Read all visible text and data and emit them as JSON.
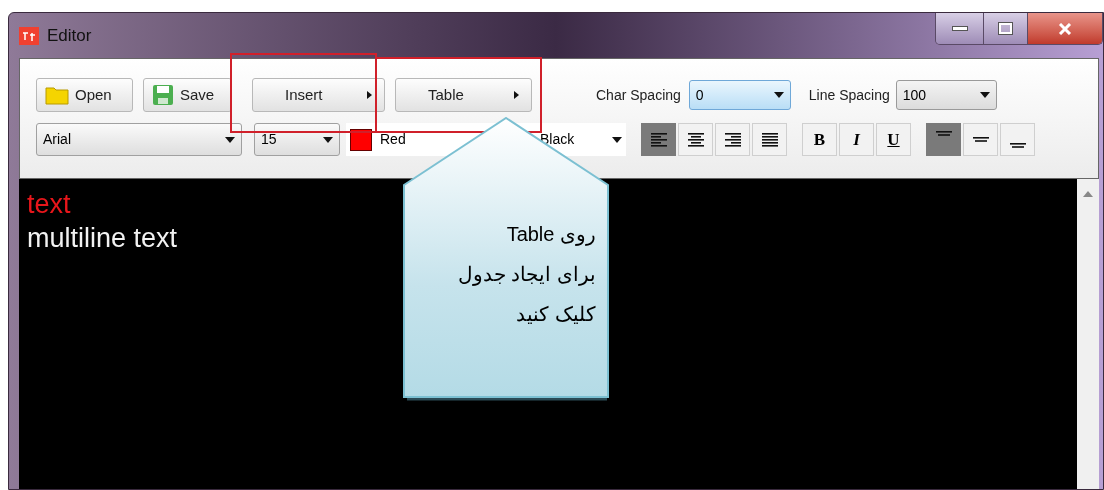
{
  "window": {
    "title": "Editor"
  },
  "toolbar": {
    "buttons": [
      {
        "label": "Open",
        "kind": "open"
      },
      {
        "label": "Save",
        "kind": "save"
      },
      {
        "label": "Insert",
        "kind": "menu"
      },
      {
        "label": "Table",
        "kind": "menu"
      }
    ],
    "char_spacing": {
      "label": "Char Spacing",
      "value": "0",
      "focused": true
    },
    "line_spacing": {
      "label": "Line Spacing",
      "value": "100",
      "focused": false
    }
  },
  "format_bar": {
    "font": "Arial",
    "size": "15",
    "text_color": {
      "value": "Red",
      "color": "#ff0000"
    },
    "background_color": {
      "value": "Black"
    },
    "align": [
      {
        "kind": "left",
        "selected": true
      },
      {
        "kind": "center",
        "selected": false
      },
      {
        "kind": "right",
        "selected": false
      },
      {
        "kind": "justify",
        "selected": false
      }
    ],
    "styles": [
      {
        "label": "B",
        "kind": "bold"
      },
      {
        "label": "I",
        "kind": "italic"
      },
      {
        "label": "U",
        "kind": "underline"
      }
    ],
    "valign": [
      {
        "kind": "top",
        "selected": true
      },
      {
        "kind": "middle",
        "selected": false
      },
      {
        "kind": "bottom",
        "selected": false
      }
    ]
  },
  "editor": {
    "lines": [
      {
        "text": "text",
        "color": "#e8161b"
      },
      {
        "text": "multiline text",
        "color": "#f2f2f2"
      }
    ]
  },
  "callout": {
    "text": "روی Table\nبرای ایجاد جدول\nکلیک کنید"
  }
}
